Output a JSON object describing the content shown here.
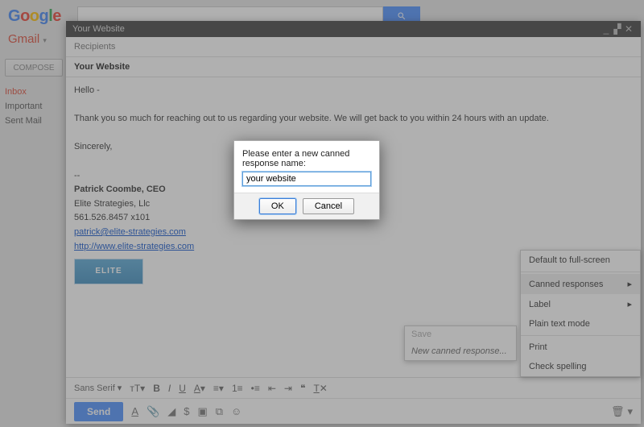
{
  "topbar": {
    "logo_letters": [
      "G",
      "o",
      "o",
      "g",
      "l",
      "e"
    ],
    "search_value": ""
  },
  "brand": {
    "label": "Gmail",
    "caret": "▾"
  },
  "sidebar": {
    "compose_label": "COMPOSE",
    "folders": [
      {
        "label": "Inbox",
        "selected": true
      },
      {
        "label": "Important",
        "selected": false
      },
      {
        "label": "Sent Mail",
        "selected": false
      }
    ]
  },
  "compose_win": {
    "title": "Your Website",
    "recipients_placeholder": "Recipients",
    "subject": "Your Website",
    "body_greeting": "Hello -",
    "body_text": "Thank you so much for reaching out to us regarding your website. We will get back to you within 24 hours with an update.",
    "body_signoff": "Sincerely,",
    "sig_name": "Patrick Coombe, CEO",
    "sig_company": "Elite Strategies, Llc",
    "sig_phone": "561.526.8457 x101",
    "sig_email": "patrick@elite-strategies.com",
    "sig_url": "http://www.elite-strategies.com",
    "sig_logo_text": "ELITE"
  },
  "format_bar": {
    "font_label": "Sans Serif",
    "items": [
      "size",
      "B",
      "I",
      "U",
      "A",
      "align",
      "list-num",
      "list-bul",
      "indent-l",
      "indent-r",
      "quote",
      "clear"
    ]
  },
  "send_bar": {
    "send_label": "Send"
  },
  "more_menu": {
    "items": [
      {
        "label": "Default to full-screen",
        "submenu": false,
        "highlight": false
      },
      {
        "sep": true
      },
      {
        "label": "Canned responses",
        "submenu": true,
        "highlight": true
      },
      {
        "label": "Label",
        "submenu": true,
        "highlight": false
      },
      {
        "label": "Plain text mode",
        "submenu": false,
        "highlight": false
      },
      {
        "sep": true
      },
      {
        "label": "Print",
        "submenu": false,
        "highlight": false
      },
      {
        "label": "Check spelling",
        "submenu": false,
        "highlight": false
      }
    ]
  },
  "sub_panel": {
    "head": "Save",
    "row": "New canned response..."
  },
  "modal": {
    "prompt": "Please enter a new canned response name:",
    "value": "your website",
    "ok": "OK",
    "cancel": "Cancel"
  }
}
